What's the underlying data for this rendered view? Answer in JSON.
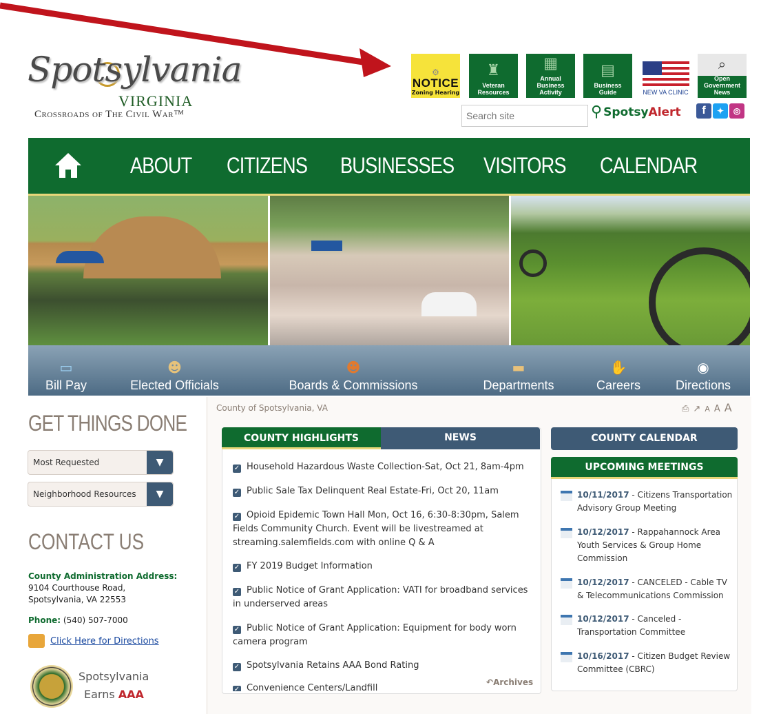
{
  "logo": {
    "script_text": "Spotsylvania",
    "state": "VIRGINIA",
    "tagline": "Crossroads of The Civil War™"
  },
  "quick_links": [
    {
      "label": "NOTICE",
      "sub": "Zoning Hearing",
      "icon": "notice-icon"
    },
    {
      "label": "Veteran Resources",
      "icon": "soldier-icon"
    },
    {
      "label": "Annual Business Activity",
      "icon": "briefcase-icon"
    },
    {
      "label": "Business Guide",
      "icon": "book-icon"
    },
    {
      "label": "NEW VA CLINIC",
      "icon": "flag-icon"
    },
    {
      "label": "Open Government News",
      "icon": "magnifier-icon"
    }
  ],
  "search": {
    "placeholder": "Search site"
  },
  "spotsy_alert": {
    "prefix": "Spotsy",
    "suffix": "Alert"
  },
  "social": [
    "f",
    "t",
    "ig"
  ],
  "main_nav": [
    "ABOUT",
    "CITIZENS",
    "BUSINESSES",
    "VISITORS",
    "CALENDAR"
  ],
  "icon_bar": [
    {
      "label": "Bill Pay",
      "icon": "credit-card-icon"
    },
    {
      "label": "Elected Officials",
      "icon": "officials-icon"
    },
    {
      "label": "Boards & Commissions",
      "icon": "group-icon"
    },
    {
      "label": "Departments",
      "icon": "folder-icon"
    },
    {
      "label": "Careers",
      "icon": "hand-icon"
    },
    {
      "label": "Directions",
      "icon": "compass-icon"
    }
  ],
  "left": {
    "get_things_done": "GET THINGS DONE",
    "dropdown1": "Most Requested",
    "dropdown2": "Neighborhood Resources",
    "contact_title": "CONTACT US",
    "address_label": "County Administration Address:",
    "address_line1": "9104 Courthouse Road,",
    "address_line2": "Spotsylvania, VA 22553",
    "phone_label": "Phone:",
    "phone": "(540) 507-7000",
    "directions_link": "Click Here for Directions",
    "earns_line1": "Spotsylvania",
    "earns_line2": "Earns",
    "earns_aaa": "AAA"
  },
  "breadcrumb": "County of Spotsylvania, VA",
  "text_size": [
    "A",
    "A",
    "A"
  ],
  "tabs": {
    "highlights": "COUNTY HIGHLIGHTS",
    "news": "NEWS"
  },
  "highlights": [
    "Household Hazardous Waste Collection-Sat, Oct 21, 8am-4pm",
    "Public Sale Tax Delinquent Real Estate-Fri, Oct 20, 11am",
    "Opioid Epidemic Town Hall Mon, Oct 16, 6:30-8:30pm, Salem Fields Community Church. Event will be livestreamed at streaming.salemfields.com with online Q & A",
    "FY 2019 Budget Information",
    "Public Notice of Grant Application: VATI for broadband services in underserved areas",
    "Public Notice of Grant Application: Equipment for body worn camera program",
    "Spotsylvania Retains AAA Bond Rating",
    "Convenience Centers/Landfill"
  ],
  "archives": "Archives",
  "calendar": {
    "header": "COUNTY CALENDAR",
    "meetings_header": "UPCOMING MEETINGS",
    "meetings": [
      {
        "date": "10/11/2017",
        "title": "Citizens Transportation Advisory Group Meeting"
      },
      {
        "date": "10/12/2017",
        "title": "Rappahannock Area Youth Services & Group Home Commission"
      },
      {
        "date": "10/12/2017",
        "title": "CANCELED - Cable TV & Telecommunications Commission"
      },
      {
        "date": "10/12/2017",
        "title": "Canceled - Transportation Committee"
      },
      {
        "date": "10/16/2017",
        "title": "Citizen Budget Review Committee (CBRC)"
      }
    ]
  },
  "colors": {
    "green": "#0f6b2f",
    "slate": "#3e5a75",
    "accent_red": "#c0272d"
  }
}
